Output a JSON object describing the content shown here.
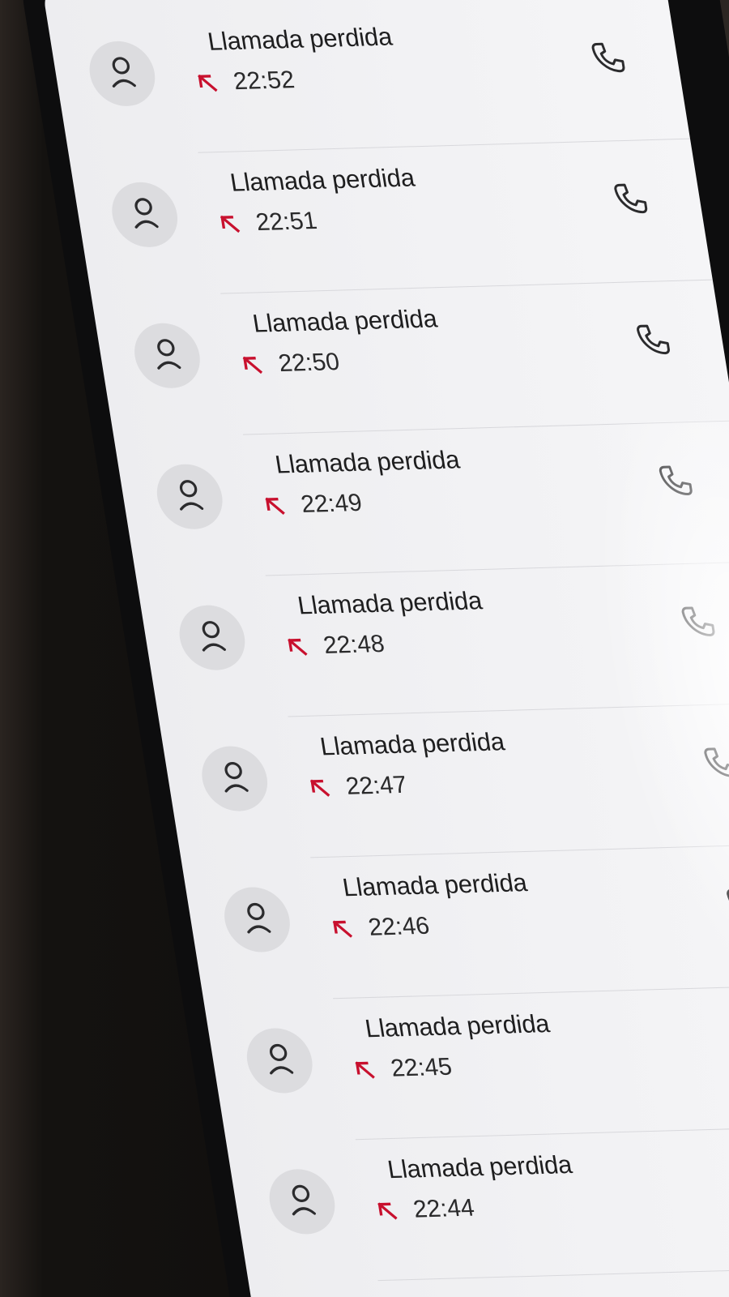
{
  "call_log": {
    "entries": [
      {
        "label": "Llamada perdida",
        "time": "22:52"
      },
      {
        "label": "Llamada perdida",
        "time": "22:51"
      },
      {
        "label": "Llamada perdida",
        "time": "22:50"
      },
      {
        "label": "Llamada perdida",
        "time": "22:49"
      },
      {
        "label": "Llamada perdida",
        "time": "22:48"
      },
      {
        "label": "Llamada perdida",
        "time": "22:47"
      },
      {
        "label": "Llamada perdida",
        "time": "22:46"
      },
      {
        "label": "Llamada perdida",
        "time": "22:45"
      },
      {
        "label": "Llamada perdida",
        "time": "22:44"
      }
    ]
  },
  "icons": {
    "avatar": "person-icon",
    "missed": "missed-call-arrow-icon",
    "call": "phone-icon"
  },
  "colors": {
    "missed_accent": "#c8102e",
    "screen_background": "#f2f2f4",
    "avatar_background": "#dcdcdf"
  }
}
